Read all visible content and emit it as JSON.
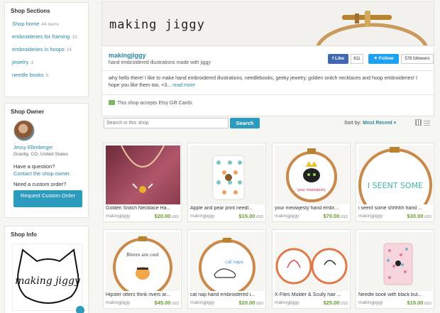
{
  "sidebar": {
    "sections_title": "Shop Sections",
    "sections": [
      {
        "label": "Shop home",
        "count": "44 items"
      },
      {
        "label": "embroideries for framing",
        "count": "10"
      },
      {
        "label": "embroideries in hoops",
        "count": "24"
      },
      {
        "label": "jewelry",
        "count": "3"
      },
      {
        "label": "needle books",
        "count": "5"
      }
    ],
    "owner_title": "Shop Owner",
    "owner_name": "Jessy Ellenberger",
    "owner_location": "Granby, CO, United States",
    "question_label": "Have a question?",
    "contact_link": "Contact the shop owner.",
    "custom_label": "Need a custom order?",
    "request_button": "Request Custom Order",
    "info_title": "Shop Info"
  },
  "banner": {
    "title": "making jiggy"
  },
  "shop": {
    "name": "makingjiggy",
    "tagline": "hand embroidered illustrations made with jiggy",
    "fb_like": "Like",
    "fb_count": "811",
    "tw_follow": "Follow",
    "tw_count": "578 followers",
    "description": "why hello there! I like to make hand embroidered illustrations, needlebooks, geeky jewelry, golden snitch necklaces and hoop embroideries! I hope you like them too. <3...",
    "read_more": "read more",
    "gift_cards": "This shop accepts Etsy Gift Cards."
  },
  "search": {
    "placeholder": "Search in this shop",
    "button": "Search"
  },
  "sort": {
    "label": "Sort by:",
    "value": "Most Recent"
  },
  "listings": [
    {
      "title": "Golden Snitch Necklace Ha...",
      "shop": "makingjiggy",
      "price": "$20.00",
      "currency": "USD"
    },
    {
      "title": "Apple and pear print needl...",
      "shop": "makingjiggy",
      "price": "$15.00",
      "currency": "USD"
    },
    {
      "title": "your meowjesty hand embr...",
      "shop": "makingjiggy",
      "price": "$70.00",
      "currency": "USD"
    },
    {
      "title": "i seent some shhhhh hand ...",
      "shop": "makingjiggy",
      "price": "$30.00",
      "currency": "USD"
    },
    {
      "title": "Hipster otters think rivers ar...",
      "shop": "makingjiggy",
      "price": "$45.00",
      "currency": "USD"
    },
    {
      "title": "cat nap hand embroidered i...",
      "shop": "makingjiggy",
      "price": "$20.00",
      "currency": "USD"
    },
    {
      "title": "X-Files Mulder & Scully hair ...",
      "shop": "makingjiggy",
      "price": "$25.00",
      "currency": "USD"
    },
    {
      "title": "Needle book with black but...",
      "shop": "makingjiggy",
      "price": "$15.00",
      "currency": "USD"
    }
  ],
  "thumb_text": {
    "hoop_i_seent": "I SEENT SOME",
    "meowjesty": "your meowjesty",
    "cat_nap": "cat naps",
    "otters": "Rivers are cool",
    "logo": "making jiggy"
  },
  "colors": {
    "accent": "#2a86a7",
    "button": "#2d9bbd",
    "price": "#6a9b31"
  }
}
